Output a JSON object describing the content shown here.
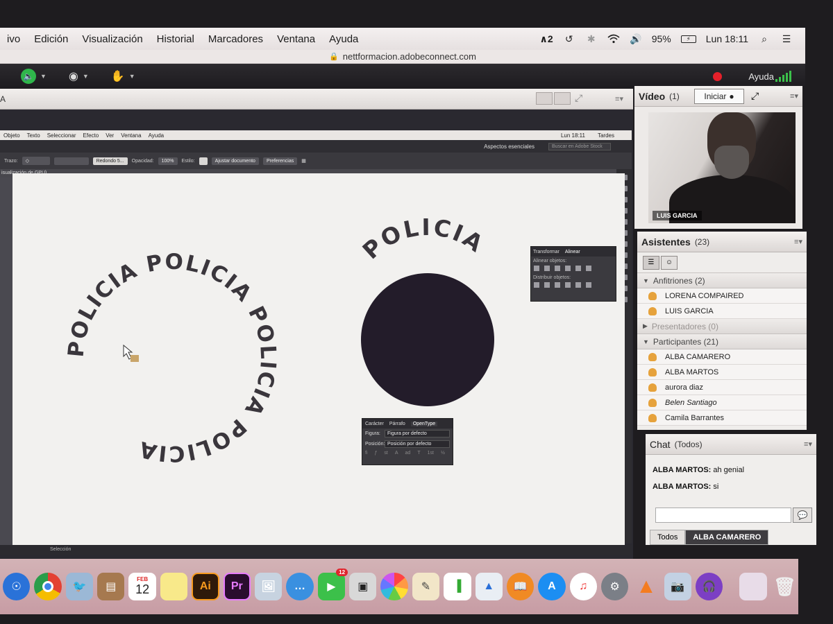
{
  "menubar": {
    "items": [
      "ivo",
      "Edición",
      "Visualización",
      "Historial",
      "Marcadores",
      "Ventana",
      "Ayuda"
    ],
    "adobe_badge": "2",
    "battery": "95%",
    "clock": "Lun 18:11"
  },
  "url": "nettformacion.adobeconnect.com",
  "connect_bar": {
    "help_label": "Ayuda"
  },
  "share_pod": {
    "header_label": "A"
  },
  "illustrator": {
    "menu": [
      "Objeto",
      "Texto",
      "Seleccionar",
      "Efecto",
      "Ver",
      "Ventana",
      "Ayuda"
    ],
    "menu_clock": "Lun 18:11",
    "menu_user": "Tardes",
    "workspace_label": "Aspectos esenciales",
    "search_placeholder": "Buscar en Adobe Stock",
    "control_bar": {
      "stroke_label": "Trazo:",
      "brush_label": "Redondo 5...",
      "opacity_label": "Opacidad:",
      "opacity_value": "100%",
      "style_label": "Estilo:",
      "fit_doc_button": "Ajustar documento",
      "prefs_button": "Preferencias"
    },
    "tab_label": "isualización de GPU)",
    "status_label": "Selección",
    "artwork_text": "POLICIA",
    "circle_fill": "#231c2a",
    "align_panel": {
      "tab_transform": "Transformar",
      "tab_align": "Alinear",
      "align_objects": "Alinear objetos:",
      "distribute_objects": "Distribuir objetos:"
    },
    "type_panel": {
      "tab_character": "Carácter",
      "tab_paragraph": "Párrafo",
      "tab_opentype": "OpenType",
      "figure_label": "Figura:",
      "figure_value": "Figura por defecto",
      "position_label": "Posición:",
      "position_value": "Posición por defecto"
    }
  },
  "video_pod": {
    "title": "Vídeo",
    "count": "(1)",
    "start_button": "Iniciar",
    "name_overlay": "LUIS GARCIA"
  },
  "attendees_pod": {
    "title": "Asistentes",
    "count": "(23)",
    "groups": {
      "hosts": "Anfitriones (2)",
      "presenters": "Presentadores (0)",
      "participants": "Participantes (21)"
    },
    "hosts": [
      "LORENA COMPAIRED",
      "LUIS GARCIA"
    ],
    "participants": [
      "ALBA CAMARERO",
      "ALBA MARTOS",
      "aurora diaz",
      "Belen Santiago",
      "Camila Barrantes"
    ]
  },
  "chat_pod": {
    "title": "Chat",
    "scope": "(Todos)",
    "messages": [
      {
        "sender": "ALBA MARTOS:",
        "text": " ah genial"
      },
      {
        "sender": "ALBA MARTOS:",
        "text": " si"
      }
    ],
    "tabs": [
      "Todos",
      "ALBA CAMARERO"
    ]
  },
  "dock": {
    "calendar_month": "FEB",
    "calendar_day": "12",
    "ai_label": "Ai",
    "pr_label": "Pr",
    "facetime_badge": "12"
  }
}
